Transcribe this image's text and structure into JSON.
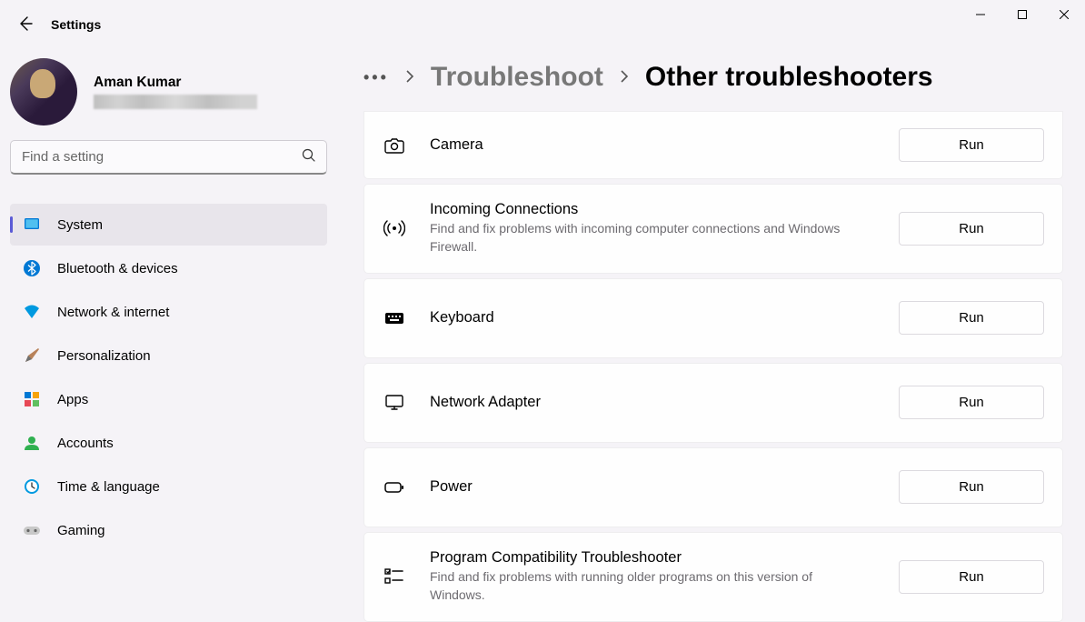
{
  "app_title": "Settings",
  "profile": {
    "name": "Aman Kumar"
  },
  "search": {
    "placeholder": "Find a setting"
  },
  "sidebar": {
    "items": [
      {
        "label": "System",
        "icon": "system"
      },
      {
        "label": "Bluetooth & devices",
        "icon": "bluetooth"
      },
      {
        "label": "Network & internet",
        "icon": "wifi"
      },
      {
        "label": "Personalization",
        "icon": "brush"
      },
      {
        "label": "Apps",
        "icon": "apps"
      },
      {
        "label": "Accounts",
        "icon": "account"
      },
      {
        "label": "Time & language",
        "icon": "clock"
      },
      {
        "label": "Gaming",
        "icon": "gaming"
      }
    ]
  },
  "breadcrumb": {
    "parent": "Troubleshoot",
    "current": "Other troubleshooters"
  },
  "troubleshooters": [
    {
      "title": "Camera",
      "desc": "",
      "icon": "camera",
      "run": "Run"
    },
    {
      "title": "Incoming Connections",
      "desc": "Find and fix problems with incoming computer connections and Windows Firewall.",
      "icon": "antenna",
      "run": "Run"
    },
    {
      "title": "Keyboard",
      "desc": "",
      "icon": "keyboard",
      "run": "Run"
    },
    {
      "title": "Network Adapter",
      "desc": "",
      "icon": "adapter",
      "run": "Run"
    },
    {
      "title": "Power",
      "desc": "",
      "icon": "power",
      "run": "Run"
    },
    {
      "title": "Program Compatibility Troubleshooter",
      "desc": "Find and fix problems with running older programs on this version of Windows.",
      "icon": "compat",
      "run": "Run"
    }
  ]
}
